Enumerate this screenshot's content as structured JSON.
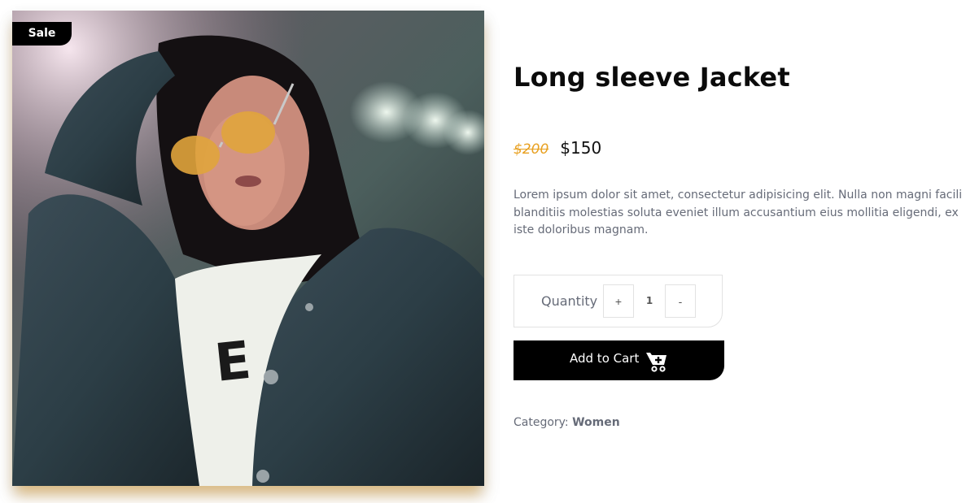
{
  "badge": {
    "label": "Sale"
  },
  "product": {
    "title": "Long sleeve Jacket",
    "old_price": "$200",
    "price": "$150",
    "description": "Lorem ipsum dolor sit amet, consectetur adipisicing elit. Nulla non magni facili blanditiis molestias soluta eveniet illum accusantium eius mollitia eligendi, ex iste doloribus magnam."
  },
  "quantity": {
    "label": "Quantity",
    "plus_label": "+",
    "value": "1",
    "minus_label": "-"
  },
  "cart": {
    "label": "Add to Cart",
    "icon": "cart-plus-icon"
  },
  "category": {
    "prefix": "Category:",
    "value": "Women"
  },
  "colors": {
    "accent": "#e8a020",
    "button": "#000000",
    "text_muted": "#666b78"
  }
}
